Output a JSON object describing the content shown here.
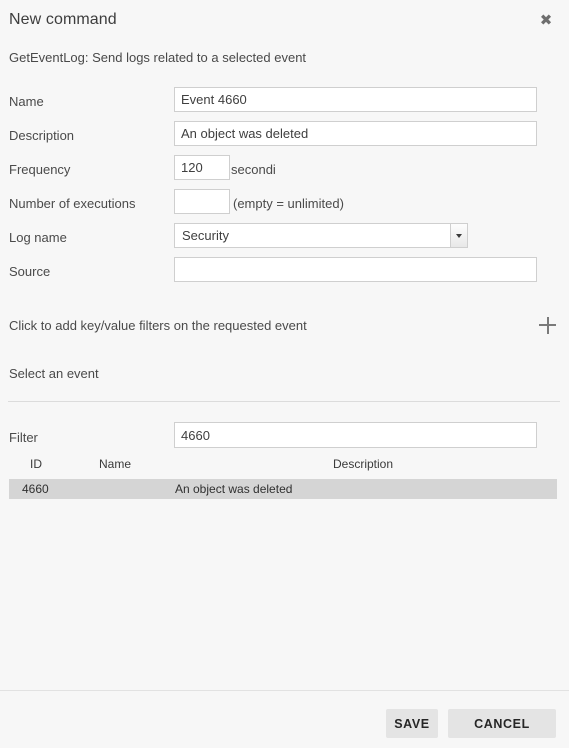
{
  "dialog": {
    "title": "New command",
    "close_icon": "close-icon",
    "subtitle": "GetEventLog: Send logs related to a selected event"
  },
  "form": {
    "fields": [
      {
        "label": "Name",
        "value": "Event 4660",
        "type": "text",
        "suffix": ""
      },
      {
        "label": "Description",
        "value": "An object was deleted",
        "type": "text",
        "suffix": ""
      },
      {
        "label": "Frequency",
        "value": "120",
        "type": "number",
        "suffix": "secondi"
      },
      {
        "label": "Number of executions",
        "value": "",
        "type": "number",
        "suffix": "(empty = unlimited)"
      },
      {
        "label": "Log name",
        "value": "Security",
        "type": "select",
        "suffix": ""
      },
      {
        "label": "Source",
        "value": "",
        "type": "text",
        "suffix": ""
      }
    ],
    "log_name_options": [
      "Security"
    ]
  },
  "filters": {
    "text": "Click to add key/value filters on the requested event",
    "add_icon": "plus-icon"
  },
  "event_section": {
    "title": "Select an event",
    "filter_label": "Filter",
    "filter_value": "4660",
    "columns": [
      "ID",
      "Name",
      "Description"
    ],
    "rows": [
      {
        "id": "4660",
        "name": "",
        "description": "An object was deleted",
        "selected": true
      }
    ]
  },
  "footer": {
    "save_label": "SAVE",
    "cancel_label": "CANCEL"
  },
  "colors": {
    "background": "#f7f7f7",
    "field_border": "#cfcfcf",
    "selected_row": "#d5d5d5",
    "button": "#e4e4e4",
    "divider": "#dcdcdc"
  }
}
